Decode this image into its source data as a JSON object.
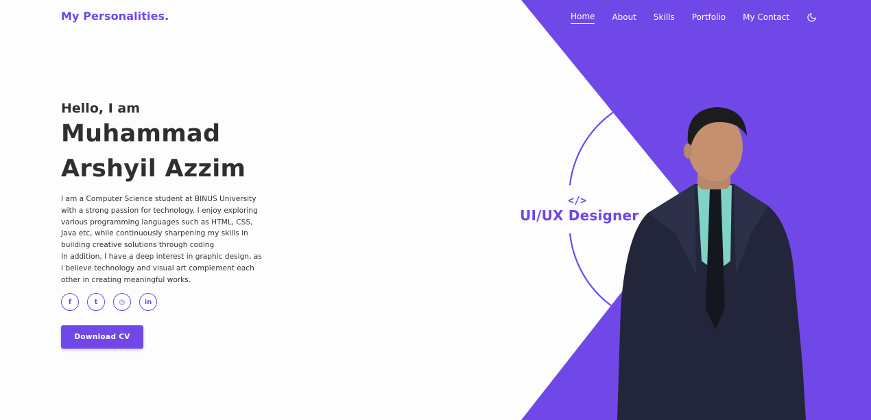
{
  "brand": {
    "logo": "My Personalities."
  },
  "nav": {
    "items": [
      {
        "label": "Home",
        "active": true
      },
      {
        "label": "About",
        "active": false
      },
      {
        "label": "Skills",
        "active": false
      },
      {
        "label": "Portfolio",
        "active": false
      },
      {
        "label": "My Contact",
        "active": false
      }
    ],
    "theme_toggle_icon": "moon-icon"
  },
  "hero": {
    "greeting": "Hello, I am",
    "name_line1": "Muhammad",
    "name_line2": "Arshyil Azzim",
    "bio_paragraph1": "I am a Computer Science student at BINUS University with a strong passion for technology. I enjoy exploring various programming languages such as HTML, CSS, Java etc, while continuously sharpening my skills in building creative solutions through coding",
    "bio_paragraph2": "In addition, I have a deep interest in graphic design, as I believe technology and visual art complement each other in creating meaningful works.",
    "cta_label": "Download CV"
  },
  "socials": [
    {
      "icon": "facebook-icon",
      "glyph": "f"
    },
    {
      "icon": "twitter-icon",
      "glyph": "t"
    },
    {
      "icon": "instagram-icon",
      "glyph": "◎"
    },
    {
      "icon": "linkedin-icon",
      "glyph": "in"
    }
  ],
  "role": {
    "code_icon": "</>",
    "title": "UI/UX Designer"
  },
  "colors": {
    "accent": "#7048e8",
    "text": "#2f2f2f",
    "background": "#fdfdfd"
  }
}
